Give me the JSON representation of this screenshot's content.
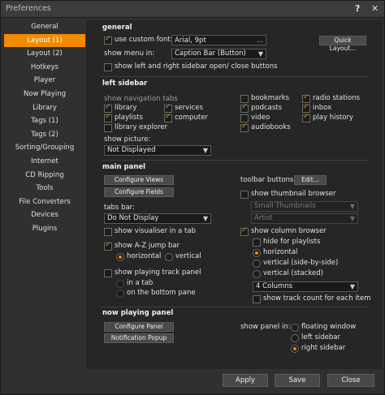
{
  "window": {
    "title": "Preferences",
    "help_icon": "?",
    "close_icon": "✕"
  },
  "sidebar": {
    "items": [
      {
        "label": "General"
      },
      {
        "label": "Layout (1)"
      },
      {
        "label": "Layout (2)"
      },
      {
        "label": "Hotkeys"
      },
      {
        "label": "Player"
      },
      {
        "label": "Now Playing"
      },
      {
        "label": "Library"
      },
      {
        "label": "Tags (1)"
      },
      {
        "label": "Tags (2)"
      },
      {
        "label": "Sorting/Grouping"
      },
      {
        "label": "Internet"
      },
      {
        "label": "CD Ripping"
      },
      {
        "label": "Tools"
      },
      {
        "label": "File Converters"
      },
      {
        "label": "Devices"
      },
      {
        "label": "Plugins"
      }
    ],
    "active_index": 1
  },
  "general": {
    "title": "general",
    "use_custom_font": "use custom font:",
    "font_value": "Arial, 9pt",
    "font_dots": "...",
    "quick_layout": "Quick Layout...",
    "show_menu_in": "show menu in:",
    "menu_value": "Caption Bar (Button)",
    "show_sidebar_buttons": "show left and right sidebar open/ close buttons"
  },
  "left_sidebar": {
    "title": "left sidebar",
    "show_nav_tabs": "show navigation tabs",
    "tabs": {
      "library": "library",
      "services": "services",
      "playlists": "playlists",
      "computer": "computer",
      "library_explorer": "library explorer",
      "bookmarks": "bookmarks",
      "podcasts": "podcasts",
      "video": "video",
      "audiobooks": "audiobooks",
      "radio_stations": "radio stations",
      "inbox": "inbox",
      "play_history": "play history"
    },
    "show_picture": "show picture:",
    "picture_value": "Not Displayed"
  },
  "main_panel": {
    "title": "main panel",
    "configure_views": "Configure Views",
    "configure_fields": "Configure Fields",
    "tabs_bar": "tabs bar:",
    "tabs_bar_value": "Do Not Display",
    "show_visualiser": "show visualiser in a tab",
    "show_az": "show A-Z jump bar",
    "horizontal": "horizontal",
    "vertical": "vertical",
    "show_playing_track": "show playing track panel",
    "in_a_tab": "in a tab",
    "on_bottom_pane": "on the bottom pane",
    "toolbar_buttons": "toolbar buttons:",
    "edit": "Edit...",
    "show_thumbnail": "show thumbnail browser",
    "thumb_size": "Small Thumbnails",
    "thumb_group": "Artist",
    "show_column_browser": "show column browser",
    "hide_for_playlists": "hide for playlists",
    "col_horizontal": "horizontal",
    "col_vertical_sbs": "vertical (side-by-side)",
    "col_vertical_stacked": "vertical (stacked)",
    "columns_value": "4 Columns",
    "show_track_count": "show track count for each item"
  },
  "now_playing_panel": {
    "title": "now playing panel",
    "configure_panel": "Configure Panel",
    "notification_popup": "Notification Popup",
    "show_panel_in": "show panel in:",
    "floating_window": "floating window",
    "left_sidebar": "left sidebar",
    "right_sidebar": "right sidebar"
  },
  "footer": {
    "apply": "Apply",
    "save": "Save",
    "close": "Close"
  },
  "colors": {
    "accent": "#f08a00",
    "content_bg": "#262626",
    "window_bg": "#303030"
  }
}
